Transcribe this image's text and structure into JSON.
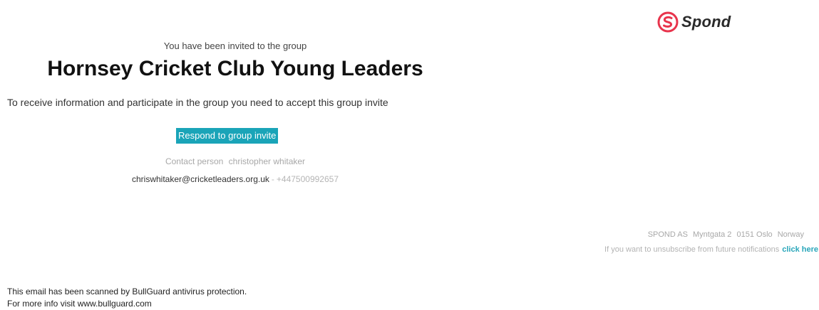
{
  "brand": {
    "name": "Spond",
    "icon": "spond-logo-icon",
    "color": "#e8344c"
  },
  "invite": {
    "intro": "You have been invited to the group",
    "group_name": "Hornsey Cricket Club Young Leaders",
    "instruction": "To receive information and participate in the group you need to accept this group invite",
    "button_label": "Respond to group invite",
    "button_color": "#1aa4b8"
  },
  "contact": {
    "label": "Contact person",
    "name": "christopher whitaker",
    "email": "chriswhitaker@cricketleaders.org.uk",
    "separator": "-",
    "phone": "+447500992657"
  },
  "footer": {
    "company": "SPOND AS",
    "street": "Myntgata 2",
    "postcode_city": "0151 Oslo",
    "country": "Norway",
    "unsubscribe_text": "If you want to unsubscribe from future notifications",
    "unsubscribe_link": "click here",
    "link_color": "#29a6ba"
  },
  "scan_notice": {
    "line1": "This email has been scanned by BullGuard antivirus protection.",
    "line2": "For more info visit www.bullguard.com"
  }
}
